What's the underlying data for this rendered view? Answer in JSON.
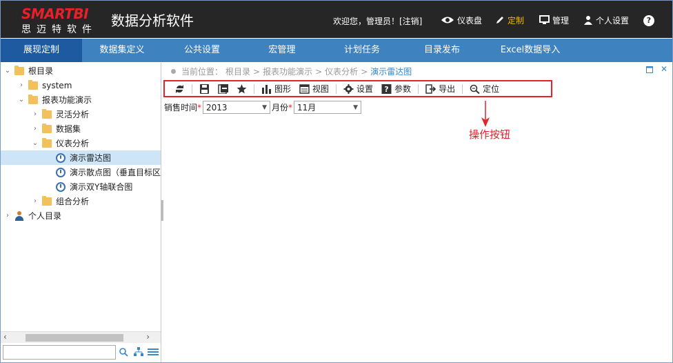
{
  "header": {
    "logo_text": "SMARTBI",
    "logo_sub": "思迈特软件",
    "app_title": "数据分析软件",
    "welcome": "欢迎您，管理员！[注销]",
    "items": [
      {
        "label": "仪表盘",
        "icon": "eye-icon"
      },
      {
        "label": "定制",
        "icon": "pencil-icon",
        "active": true
      },
      {
        "label": "管理",
        "icon": "monitor-icon"
      },
      {
        "label": "个人设置",
        "icon": "person-icon"
      }
    ],
    "help": "?"
  },
  "nav": {
    "items": [
      "展现定制",
      "数据集定义",
      "公共设置",
      "宏管理",
      "计划任务",
      "目录发布",
      "Excel数据导入"
    ]
  },
  "tree": {
    "items": [
      {
        "label": "根目录"
      },
      {
        "label": "system"
      },
      {
        "label": "报表功能演示"
      },
      {
        "label": "灵活分析"
      },
      {
        "label": "数据集"
      },
      {
        "label": "仪表分析"
      },
      {
        "label": "演示雷达图",
        "selected": true
      },
      {
        "label": "演示散点图（垂直目标区"
      },
      {
        "label": "演示双Y轴联合图"
      },
      {
        "label": "组合分析"
      },
      {
        "label": "个人目录"
      }
    ]
  },
  "breadcrumb": {
    "prefix": "当前位置：",
    "path": [
      "根目录",
      "报表功能演示",
      "仪表分析",
      "演示雷达图"
    ],
    "separator": ">"
  },
  "toolbar": {
    "chart_label": "图形",
    "view_label": "视图",
    "settings_label": "设置",
    "params_label": "参数",
    "export_label": "导出",
    "locate_label": "定位"
  },
  "params": {
    "sales_time_label": "销售时间",
    "sales_time_value": "2013",
    "month_label": "月份",
    "month_value": "11月",
    "required_mark": "*"
  },
  "annotation": {
    "label": "操作按钮",
    "color": "#e62129"
  },
  "colors": {
    "header_bg": "#262626",
    "nav_bg": "#3f82c0",
    "nav_active": "#1e5aa0",
    "accent_red": "#e62129",
    "active_gold": "#f6b400",
    "selected_row": "#cde5f7"
  }
}
